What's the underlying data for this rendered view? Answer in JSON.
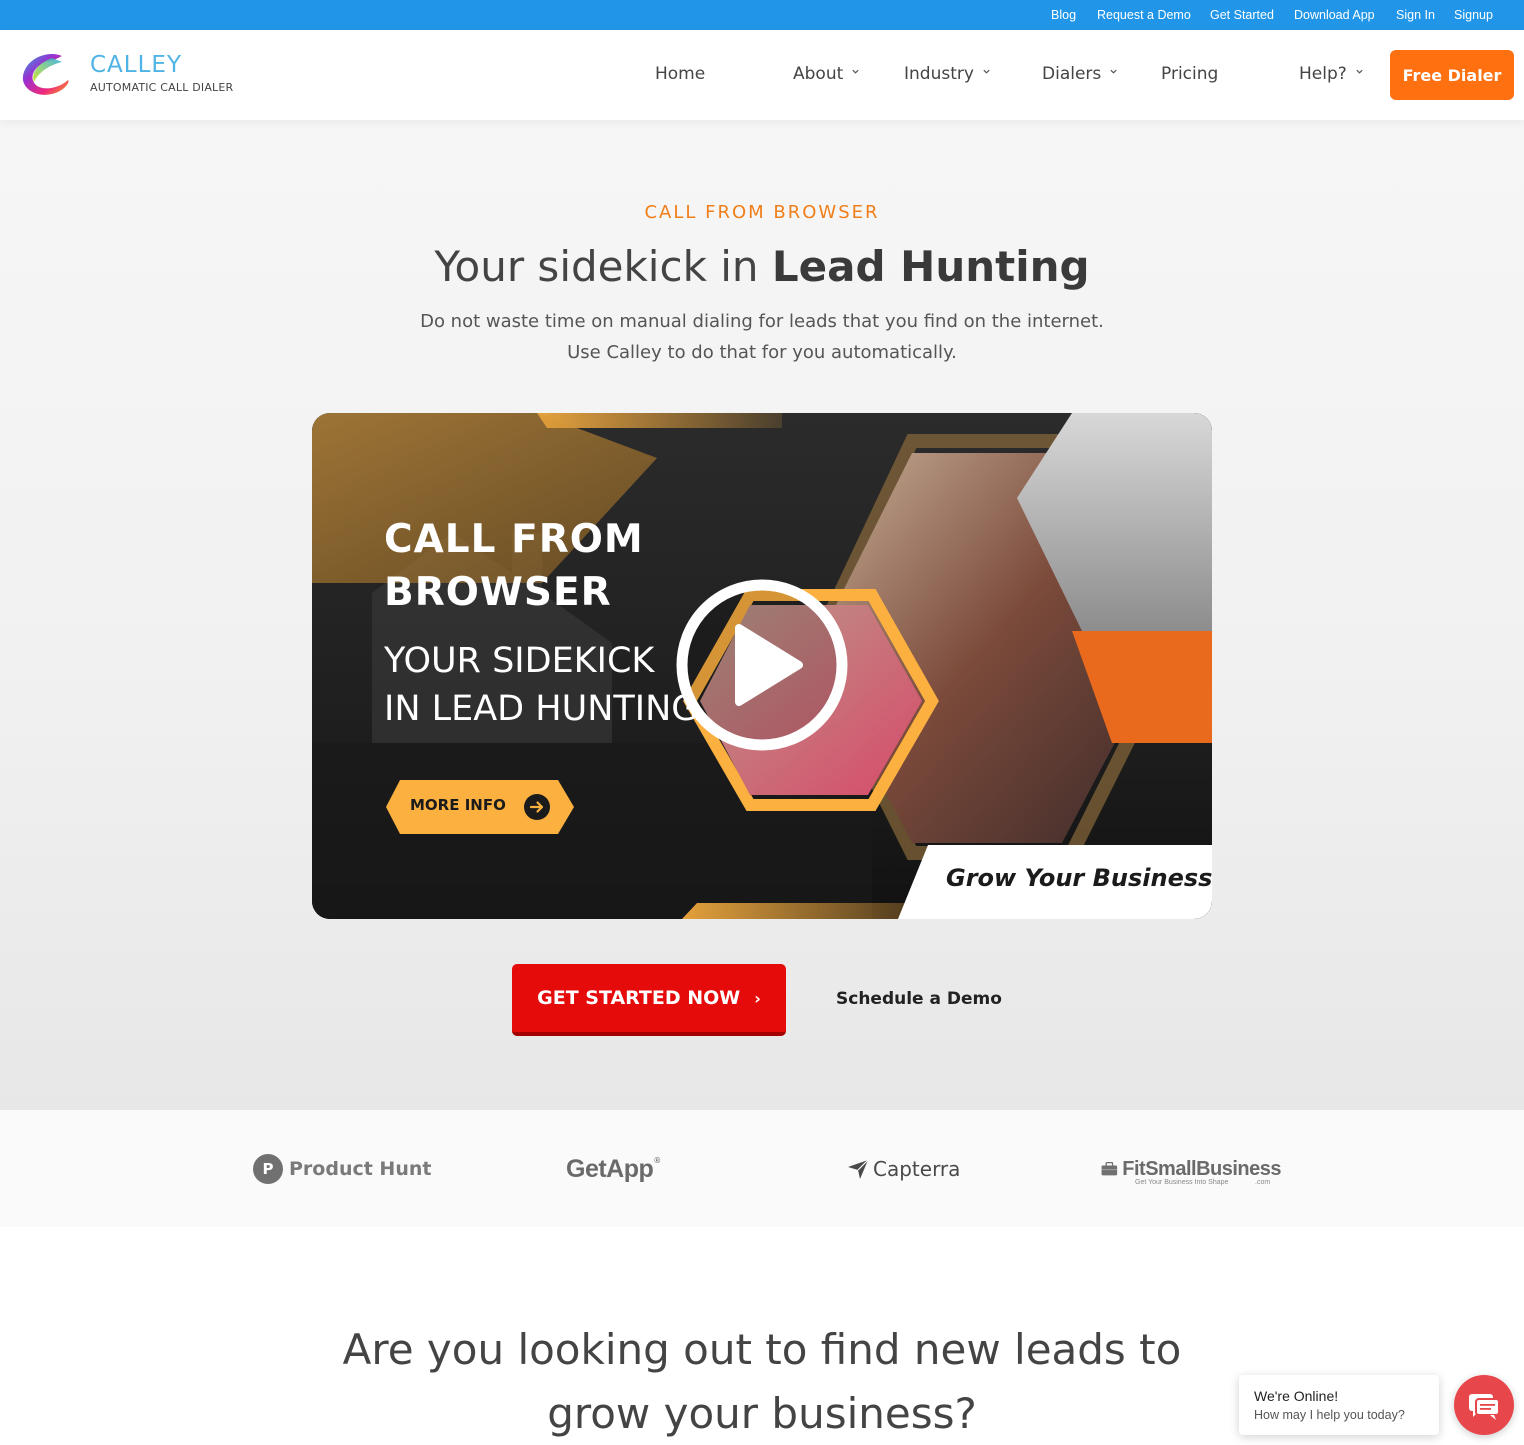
{
  "topbar": {
    "links": [
      "Blog",
      "Request a Demo",
      "Get Started",
      "Download App",
      "Sign In",
      "Signup"
    ],
    "color": "#2196e8"
  },
  "header": {
    "logo_title": "CALLEY",
    "logo_subtitle": "AUTOMATIC CALL DIALER",
    "nav": [
      {
        "label": "Home",
        "dropdown": false
      },
      {
        "label": "About",
        "dropdown": true
      },
      {
        "label": "Industry",
        "dropdown": true
      },
      {
        "label": "Dialers",
        "dropdown": true
      },
      {
        "label": "Pricing",
        "dropdown": false
      },
      {
        "label": "Help?",
        "dropdown": true
      }
    ],
    "cta_label": "Free Dialer",
    "cta_color": "#ff7011"
  },
  "hero": {
    "eyebrow": "CALL FROM BROWSER",
    "title_regular": "Your sidekick in ",
    "title_bold": "Lead Hunting",
    "subtitle_line1": "Do not waste time on manual dialing for leads that you find on the internet.",
    "subtitle_line2": "Use Calley to do that for you automatically.",
    "eyebrow_color": "#f07f1a"
  },
  "video": {
    "title_line1": "CALL FROM",
    "title_line2": "BROWSER",
    "sub_line1": "YOUR SIDEKICK",
    "sub_line2": "IN LEAD HUNTING",
    "more_info_label": "MORE INFO",
    "tagline": "Grow Your Business?",
    "accent_color": "#fbb040",
    "play_icon": "play-icon"
  },
  "cta": {
    "primary_label": "GET STARTED NOW",
    "primary_arrow": "›",
    "primary_color": "#e50b0b",
    "secondary_label": "Schedule a Demo"
  },
  "logos": {
    "product_hunt": {
      "mark": "P",
      "text": "Product Hunt"
    },
    "getapp": {
      "text": "GetApp",
      "mark": "®"
    },
    "capterra": {
      "text": "Capterra"
    },
    "fitsmallbusiness": {
      "text": "FitSmallBusiness",
      "tagline": "Get Your Business Into Shape",
      "suffix": ".com"
    }
  },
  "section": {
    "question_line1": "Are you looking out to find new leads to",
    "question_line2": "grow your business?"
  },
  "chat": {
    "title": "We're Online!",
    "subtitle": "How may I help you today?",
    "color": "#e7474b"
  }
}
